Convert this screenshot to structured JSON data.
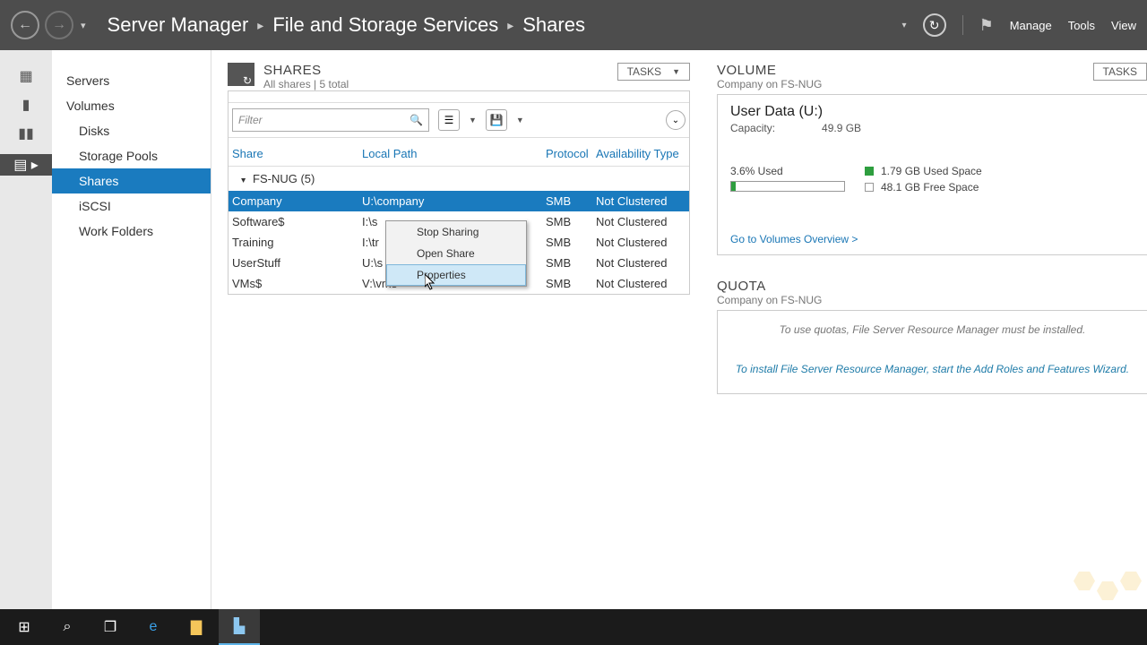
{
  "titlebar": {
    "app": "Server Manager",
    "crumb2": "File and Storage Services",
    "crumb3": "Shares",
    "manage": "Manage",
    "tools": "Tools",
    "view": "View"
  },
  "sidebar": {
    "servers": "Servers",
    "volumes": "Volumes",
    "disks": "Disks",
    "pools": "Storage Pools",
    "shares": "Shares",
    "iscsi": "iSCSI",
    "workfolders": "Work Folders"
  },
  "shares": {
    "title": "SHARES",
    "subtitle": "All shares | 5 total",
    "tasks": "TASKS",
    "filter": "Filter",
    "col_share": "Share",
    "col_path": "Local Path",
    "col_proto": "Protocol",
    "col_avail": "Availability Type",
    "group": "FS-NUG (5)",
    "rows": [
      {
        "share": "Company",
        "path": "U:\\company",
        "proto": "SMB",
        "avail": "Not Clustered"
      },
      {
        "share": "Software$",
        "path": "I:\\software",
        "proto": "SMB",
        "avail": "Not Clustered"
      },
      {
        "share": "Training",
        "path": "I:\\training",
        "proto": "SMB",
        "avail": "Not Clustered"
      },
      {
        "share": "UserStuff",
        "path": "U:\\stuff",
        "proto": "SMB",
        "avail": "Not Clustered"
      },
      {
        "share": "VMs$",
        "path": "V:\\vms",
        "proto": "SMB",
        "avail": "Not Clustered"
      }
    ]
  },
  "ctx": {
    "stop": "Stop Sharing",
    "open": "Open Share",
    "props": "Properties"
  },
  "volume": {
    "title": "VOLUME",
    "sub": "Company on FS-NUG",
    "tasks": "TASKS",
    "name": "User Data (U:)",
    "cap_label": "Capacity:",
    "cap_value": "49.9 GB",
    "used_pct": "3.6% Used",
    "used": "1.79 GB Used Space",
    "free": "48.1 GB Free Space",
    "link": "Go to Volumes Overview >"
  },
  "quota": {
    "title": "QUOTA",
    "sub": "Company on FS-NUG",
    "msg": "To use quotas, File Server Resource Manager must be installed.",
    "link": "To install File Server Resource Manager, start the Add Roles and Features Wizard."
  }
}
